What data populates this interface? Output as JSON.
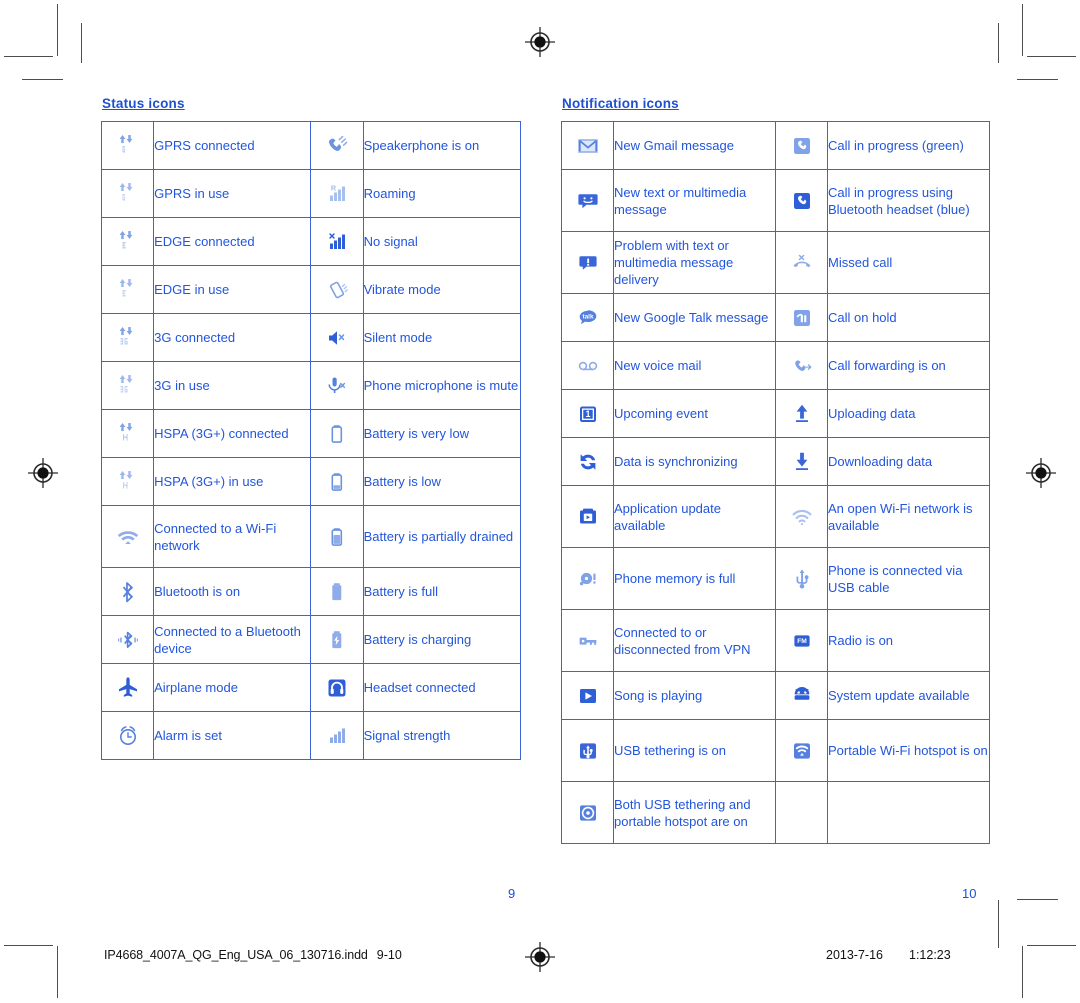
{
  "print_marks": {
    "registration_mark_name": "registration-target",
    "crop_mark_name": "crop-mark"
  },
  "left_page": {
    "title": "Status icons",
    "page_number": "9",
    "rows": [
      {
        "icon_a": "gprs-connected-icon",
        "label_a": "GPRS connected",
        "icon_b": "speakerphone-icon",
        "label_b": "Speakerphone is on"
      },
      {
        "icon_a": "gprs-in-use-icon",
        "label_a": "GPRS in use",
        "icon_b": "roaming-icon",
        "label_b": "Roaming"
      },
      {
        "icon_a": "edge-connected-icon",
        "label_a": "EDGE connected",
        "icon_b": "no-signal-icon",
        "label_b": "No signal"
      },
      {
        "icon_a": "edge-in-use-icon",
        "label_a": "EDGE in use",
        "icon_b": "vibrate-icon",
        "label_b": "Vibrate mode"
      },
      {
        "icon_a": "3g-connected-icon",
        "label_a": "3G connected",
        "icon_b": "silent-mode-icon",
        "label_b": "Silent mode"
      },
      {
        "icon_a": "3g-in-use-icon",
        "label_a": "3G in use",
        "icon_b": "mic-mute-icon",
        "label_b": "Phone microphone is mute"
      },
      {
        "icon_a": "hspa-connected-icon",
        "label_a": "HSPA (3G+) connected",
        "icon_b": "battery-very-low-icon",
        "label_b": "Battery is very low"
      },
      {
        "icon_a": "hspa-in-use-icon",
        "label_a": "HSPA (3G+) in use",
        "icon_b": "battery-low-icon",
        "label_b": "Battery is low"
      },
      {
        "icon_a": "wifi-connected-icon",
        "label_a": "Connected to a Wi-Fi network",
        "icon_b": "battery-partial-icon",
        "label_b": "Battery is partially drained"
      },
      {
        "icon_a": "bluetooth-on-icon",
        "label_a": "Bluetooth is on",
        "icon_b": "battery-full-icon",
        "label_b": "Battery is full"
      },
      {
        "icon_a": "bluetooth-connected-icon",
        "label_a": "Connected to a Bluetooth device",
        "icon_b": "battery-charging-icon",
        "label_b": "Battery is charging"
      },
      {
        "icon_a": "airplane-mode-icon",
        "label_a": "Airplane mode",
        "icon_b": "headset-icon",
        "label_b": "Headset connected"
      },
      {
        "icon_a": "alarm-icon",
        "label_a": "Alarm is set",
        "icon_b": "signal-strength-icon",
        "label_b": "Signal strength"
      }
    ]
  },
  "right_page": {
    "title": "Notification icons",
    "page_number": "10",
    "rows": [
      {
        "icon_a": "gmail-icon",
        "label_a": "New Gmail message",
        "icon_b": "call-in-progress-icon",
        "label_b": "Call in progress (green)"
      },
      {
        "icon_a": "sms-icon",
        "label_a": "New text or multimedia message",
        "icon_b": "call-bluetooth-icon",
        "label_b": "Call in progress using Bluetooth headset (blue)"
      },
      {
        "icon_a": "sms-problem-icon",
        "label_a": "Problem with text or multimedia message delivery",
        "icon_b": "missed-call-icon",
        "label_b": "Missed call"
      },
      {
        "icon_a": "google-talk-icon",
        "label_a": "New Google Talk message",
        "icon_b": "call-on-hold-icon",
        "label_b": "Call on hold"
      },
      {
        "icon_a": "voicemail-icon",
        "label_a": "New voice mail",
        "icon_b": "call-forwarding-icon",
        "label_b": "Call forwarding is on"
      },
      {
        "icon_a": "calendar-event-icon",
        "label_a": "Upcoming event",
        "icon_b": "upload-icon",
        "label_b": "Uploading data"
      },
      {
        "icon_a": "sync-icon",
        "label_a": "Data is synchronizing",
        "icon_b": "download-icon",
        "label_b": "Downloading data"
      },
      {
        "icon_a": "app-update-icon",
        "label_a": "Application update available",
        "icon_b": "open-wifi-icon",
        "label_b": "An open Wi-Fi network is available"
      },
      {
        "icon_a": "memory-full-icon",
        "label_a": "Phone memory is full",
        "icon_b": "usb-cable-icon",
        "label_b": "Phone is connected via USB cable"
      },
      {
        "icon_a": "vpn-key-icon",
        "label_a": "Connected to or disconnected from VPN",
        "icon_b": "fm-radio-icon",
        "label_b": "Radio is on"
      },
      {
        "icon_a": "play-icon",
        "label_a": "Song is playing",
        "icon_b": "android-update-icon",
        "label_b": "System update available"
      },
      {
        "icon_a": "usb-tethering-icon",
        "label_a": "USB tethering is on",
        "icon_b": "portable-hotspot-icon",
        "label_b": "Portable Wi-Fi hotspot is on"
      },
      {
        "icon_a": "both-tethering-icon",
        "label_a": "Both USB tethering and portable hotspot are on",
        "icon_b": "",
        "label_b": ""
      }
    ]
  },
  "footer": {
    "file_name": "IP4668_4007A_QG_Eng_USA_06_130716.indd",
    "page_range": "9-10",
    "date": "2013-7-16",
    "time": "1:12:23"
  },
  "colors": {
    "text_blue": "#2255dd",
    "title_blue": "#1e50d2",
    "border_blue": "#3a64d8",
    "icon_light": "#8fabea",
    "icon_solid": "#2f5fd6",
    "mark_gray": "#4d4d4d"
  }
}
